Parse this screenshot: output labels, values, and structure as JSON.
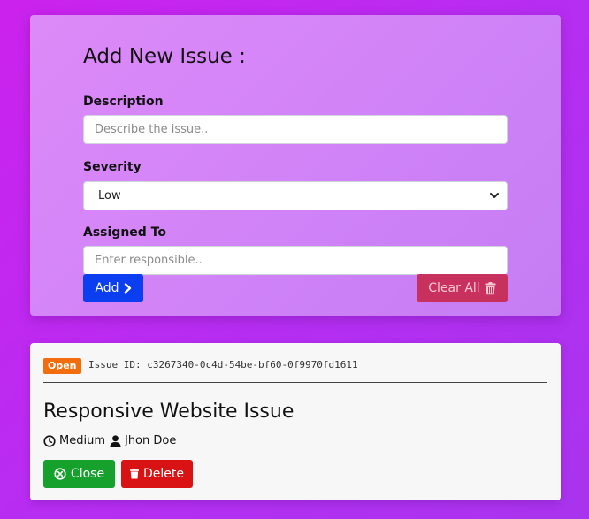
{
  "form": {
    "title": "Add New Issue :",
    "description_label": "Description",
    "description_placeholder": "Describe the issue..",
    "severity_label": "Severity",
    "severity_selected": "Low",
    "assigned_label": "Assigned To",
    "assigned_placeholder": "Enter responsible..",
    "add_label": "Add",
    "clear_label": "Clear All"
  },
  "issue": {
    "status": "Open",
    "id_text": "Issue ID: c3267340-0c4d-54be-bf60-0f9970fd1611",
    "title": "Responsive Website Issue",
    "severity": "Medium",
    "assignee": "Jhon Doe",
    "close_label": "Close",
    "delete_label": "Delete"
  },
  "colors": {
    "primary": "#0b3ef0",
    "danger_soft": "#c8315e",
    "success": "#16a12c",
    "danger": "#d91313",
    "status_open": "#f26d0b"
  },
  "icons": {
    "add": "chevron-right-icon",
    "clear": "trash-icon",
    "severity": "clock-icon",
    "assignee": "user-icon",
    "close": "circle-x-icon",
    "delete": "trash-icon",
    "select": "chevron-down-icon"
  }
}
